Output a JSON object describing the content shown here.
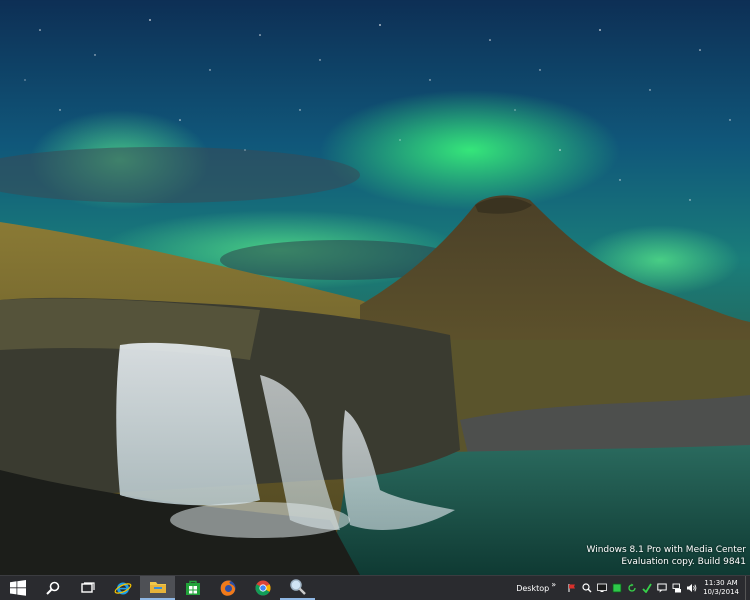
{
  "desktop": {
    "watermark_line1": "Windows 8.1 Pro with Media Center",
    "watermark_line2": "Evaluation copy. Build 9841"
  },
  "taskbar": {
    "buttons": [
      {
        "icon": "windows-logo-icon"
      },
      {
        "icon": "search-icon"
      },
      {
        "icon": "task-view-icon"
      },
      {
        "icon": "internet-explorer-icon"
      },
      {
        "icon": "file-explorer-icon"
      },
      {
        "icon": "store-icon"
      },
      {
        "icon": "firefox-icon"
      },
      {
        "icon": "chrome-icon"
      },
      {
        "icon": "magnifier-icon"
      }
    ],
    "toolbar_label": "Desktop",
    "toolbar_chevron": "»",
    "tray_icons": [
      "flag-icon",
      "magnifier-icon",
      "monitor-icon",
      "green-app-icon",
      "refresh-icon",
      "check-icon",
      "action-center-icon",
      "network-icon",
      "volume-icon"
    ],
    "clock_time": "11:30 AM",
    "clock_date": "10/3/2014",
    "colors": {
      "taskbar_bg": "#2a2b2f",
      "active_button": "#4e5055",
      "accent": "#8fb7e4"
    }
  }
}
